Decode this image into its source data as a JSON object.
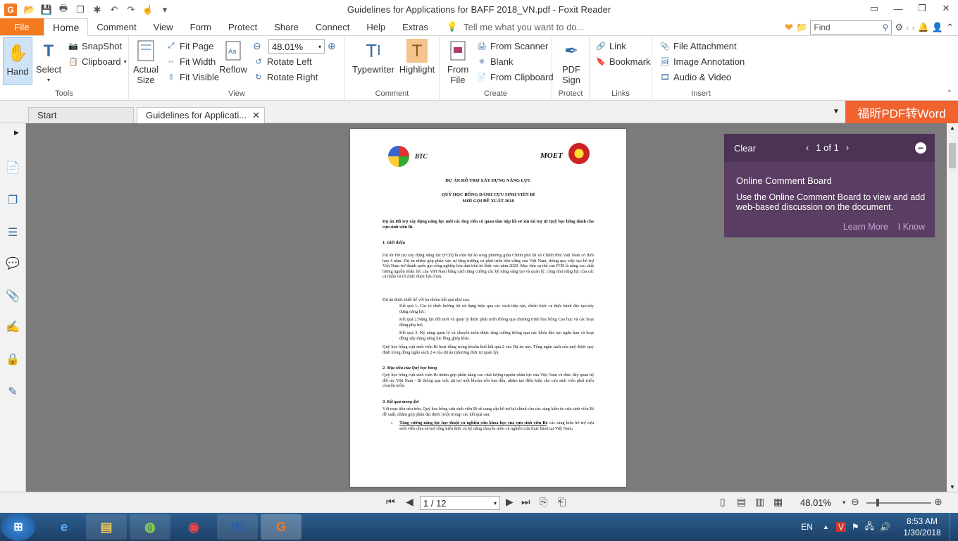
{
  "window": {
    "title": "Guidelines for Applications for BAFF  2018_VN.pdf - Foxit Reader",
    "logo_letter": "G"
  },
  "menu": {
    "file": "File",
    "tabs": [
      "Home",
      "Comment",
      "View",
      "Form",
      "Protect",
      "Share",
      "Connect",
      "Help",
      "Extras"
    ],
    "tell_me": "Tell me what you want to do...",
    "find_placeholder": "Find"
  },
  "ribbon": {
    "tools": {
      "label": "Tools",
      "hand": "Hand",
      "select": "Select",
      "snapshot": "SnapShot",
      "clipboard": "Clipboard"
    },
    "view": {
      "label": "View",
      "actual_size": "Actual Size",
      "fit_page": "Fit Page",
      "fit_width": "Fit Width",
      "fit_visible": "Fit Visible",
      "reflow": "Reflow",
      "zoom_value": "48.01%",
      "rotate_left": "Rotate Left",
      "rotate_right": "Rotate Right"
    },
    "comment": {
      "label": "Comment",
      "typewriter": "Typewriter",
      "highlight": "Highlight"
    },
    "create": {
      "label": "Create",
      "from_file": "From File",
      "from_scanner": "From Scanner",
      "blank": "Blank",
      "from_clipboard": "From Clipboard"
    },
    "protect": {
      "label": "Protect",
      "pdf_sign": "PDF Sign"
    },
    "links": {
      "label": "Links",
      "link": "Link",
      "bookmark": "Bookmark"
    },
    "insert": {
      "label": "Insert",
      "file_attachment": "File Attachment",
      "image_annotation": "Image Annotation",
      "audio_video": "Audio & Video"
    }
  },
  "doc_tabs": {
    "start": "Start",
    "active": "Guidelines for Applicati...",
    "promo": "福昕PDF转Word"
  },
  "comment_board": {
    "clear": "Clear",
    "pager": "1 of 1",
    "heading": "Online Comment Board",
    "body": "Use the Online Comment Board to view and add web-based discussion on the document.",
    "learn_more": "Learn More",
    "i_know": "I Know"
  },
  "document": {
    "logo_left": "BTC",
    "logo_right": "MOET",
    "title1": "DỰ ÁN HỖ TRỢ XÂY DỰNG NĂNG LỰC",
    "title2": "QUỸ HỌC BỔNG DÀNH CỰU SINH VIÊN BỈ",
    "title3": "MỜI GỌI ĐỀ XUẤT 2018",
    "intro": "Dự án Hỗ trợ xây dựng năng lực mời các ứng viên có quan tâm nộp hồ sơ xin tài trợ từ Quỹ học bổng dành cho cựu sinh viên Bỉ.",
    "s1": "1.   Giới thiệu",
    "p1": "Dự án Hỗ trợ xây dựng năng lực (FCB) là một dự án song phương giữa Chính phủ Bỉ và Chính Phủ Việt Nam có thời hạn 4 năm. Dự án nhằm góp phần vào sự tăng trưởng và phát triển bền vững của Việt Nam, thông qua việc tạo hỗ trợ Việt Nam trở thành quốc gia công nghiệp hóa dựa trên tri thức vào năm 2020. Mục tiêu cụ thể của FCB là nâng cao chất lượng nguồn nhân lực của Việt Nam bằng cách tăng cường các kỹ năng sáng tạo và quản lý, cũng như năng lực của các cá nhân và tổ chức được lựa chọn.",
    "p2": "Dự án được thiết kế với ba nhóm kết quả như sau:",
    "r1": "Kết quả 1: Các tổ chức hưởng lợi sử dụng hiệu quả các cách tiếp cận, chiến lược và thực hành đào tạo/xây dựng năng lực;",
    "r2": "Kết quả 2:Năng lực đổi mới và quản lý được phát triển thông qua chương trình học bổng Cao học và các hoạt động phụ trợ;",
    "r3": "Kết quả 3: Kỹ năng quản lý và chuyên môn được tăng cường thông qua các khóa đào tạo ngắn hạn và hoạt động xây dựng năng lực lồng ghép khác.",
    "p3": "Quỹ học bổng cựu sinh viên Bỉ hoạt động trong khuôn khổ kết quả 2 của Dự án này. Tổng ngân sách của quỹ được quy định trong dòng ngân sách 2.4 của dự án (phương thức tự quản lý).",
    "s2": "2.   Mục tiêu của Quỹ học bổng",
    "p4": "Quỹ học bổng cựu sinh viên Bỉ nhằm góp phần nâng cao chất lượng nguồn nhân lực của Việt Nam và thúc đẩy quan hệ đối tác Việt Nam - Bỉ thông qua việc tài trợ một khoản vốn ban đầu, nhằm tạo điều kiện cho cựu sinh viên phát triển chuyên môn.",
    "s3": "3.   Kết quả mong đợi",
    "p5": "Với mục tiêu nêu trên, Quỹ học bổng cựu sinh viên Bỉ sẽ cung cấp hỗ trợ tài chính cho các sáng kiến do cựu sinh viên Bỉ đề xuất, nhằm góp phần đạt được (một trong) các kết quả sau:",
    "b1_bold": "Tăng cường năng lực học thuật và nghiên cứu khoa học của cựu sinh viên Bỉ",
    "b1_rest": ": các sáng kiến hỗ trợ cựu sinh viên chia sẻ/mở rộng kiến thức và kỹ năng chuyên môn và nghiên cứu thực hành tại Việt Nam;"
  },
  "status": {
    "page_value": "1 / 12",
    "zoom": "48.01%"
  },
  "taskbar": {
    "lang": "EN",
    "time": "8:53 AM",
    "date": "1/30/2018"
  }
}
